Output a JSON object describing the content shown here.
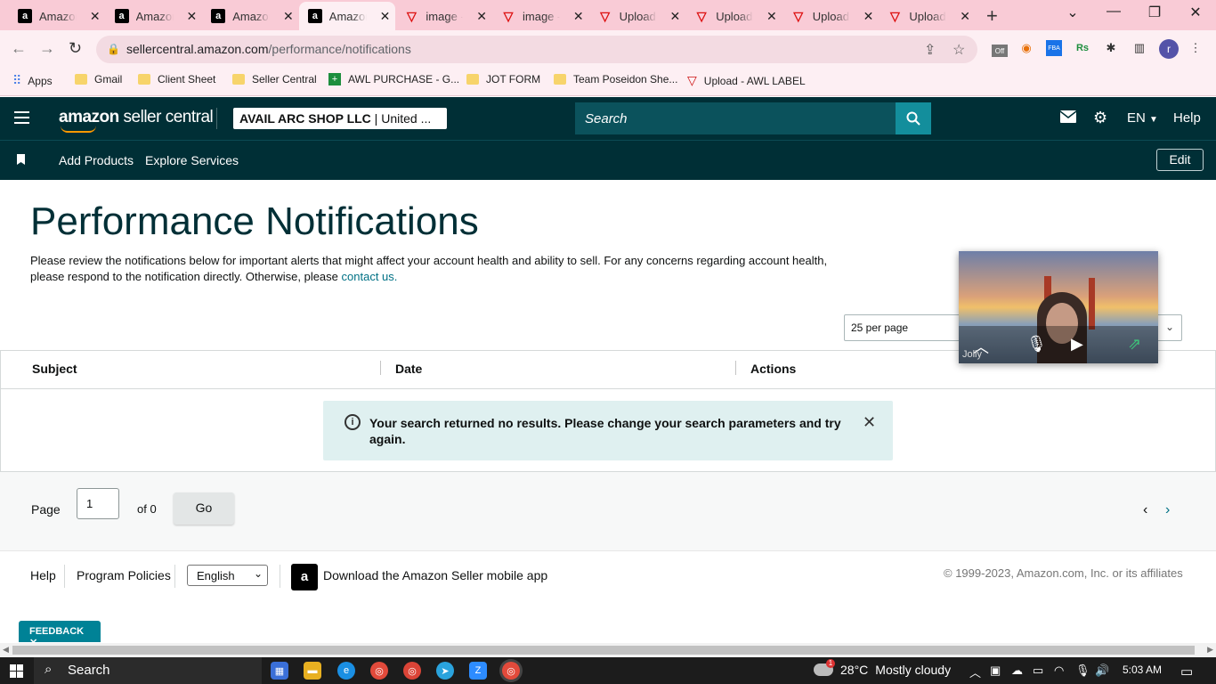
{
  "browser": {
    "tabs": [
      {
        "title": "Amazon",
        "icon": "amazon-icon",
        "active": false
      },
      {
        "title": "Amazon",
        "icon": "amazon-icon",
        "active": false
      },
      {
        "title": "Amazon",
        "icon": "amazon-icon",
        "active": false
      },
      {
        "title": "Amazon",
        "icon": "amazon-icon",
        "active": true
      },
      {
        "title": "image -",
        "icon": "jotform-icon",
        "active": false
      },
      {
        "title": "image -",
        "icon": "jotform-icon",
        "active": false
      },
      {
        "title": "Upload",
        "icon": "jotform-icon",
        "active": false
      },
      {
        "title": "Upload",
        "icon": "jotform-icon",
        "active": false
      },
      {
        "title": "Upload",
        "icon": "jotform-icon",
        "active": false
      },
      {
        "title": "Upload",
        "icon": "jotform-icon",
        "active": false
      }
    ],
    "url_host": "sellercentral.amazon.com",
    "url_path": "/performance/notifications",
    "profile_initial": "r",
    "ext_badge": "Off",
    "ext_fba": "FBA",
    "ext_rs": "Rs",
    "bookmarks": [
      {
        "label": "Apps",
        "icon": "apps-icon"
      },
      {
        "label": "Gmail",
        "icon": "folder-icon"
      },
      {
        "label": "Client Sheet",
        "icon": "folder-icon"
      },
      {
        "label": "Seller Central",
        "icon": "folder-icon"
      },
      {
        "label": "AWL PURCHASE - G...",
        "icon": "sheets-icon"
      },
      {
        "label": "JOT FORM",
        "icon": "folder-icon"
      },
      {
        "label": "Team Poseidon She...",
        "icon": "folder-icon"
      },
      {
        "label": "Upload - AWL LABEL",
        "icon": "jotform-icon"
      }
    ]
  },
  "header": {
    "logo_bold": "amazon",
    "logo_rest": " seller central",
    "store_name": "AVAIL ARC SHOP LLC",
    "store_region": " | United ...",
    "search_placeholder": "Search",
    "language": "EN",
    "help": "Help",
    "nav_links": [
      "Add Products",
      "Explore Services"
    ],
    "edit": "Edit"
  },
  "page": {
    "title": "Performance Notifications",
    "description": "Please review the notifications below for important alerts that might affect your account health and ability to sell. For any concerns regarding account health, please respond to the notification directly. Otherwise, please ",
    "contact_link": "contact us.",
    "per_page": "25 per page",
    "columns": [
      "Subject",
      "Date",
      "Actions"
    ],
    "alert_message": "Your search returned no results. Please change your search parameters and try again.",
    "pager": {
      "label": "Page",
      "value": "1",
      "of": "of 0",
      "go": "Go"
    }
  },
  "footer": {
    "links": [
      "Help",
      "Program Policies"
    ],
    "language_selected": "English",
    "app_link": "Download the Amazon Seller mobile app",
    "copyright": "© 1999-2023, Amazon.com, Inc. or its affiliates",
    "feedback": "FEEDBACK"
  },
  "video_call": {
    "participant": "Jolly"
  },
  "taskbar": {
    "search": "Search",
    "weather_temp": "28°C",
    "weather_desc": "Mostly cloudy",
    "weather_badge": "1",
    "time": "5:03 AM"
  },
  "colors": {
    "header_bg": "#002f36",
    "search_btn": "#138e9c",
    "link": "#007185",
    "feedback_bg": "#008296",
    "tabstrip_bg": "#f9cbd6"
  }
}
